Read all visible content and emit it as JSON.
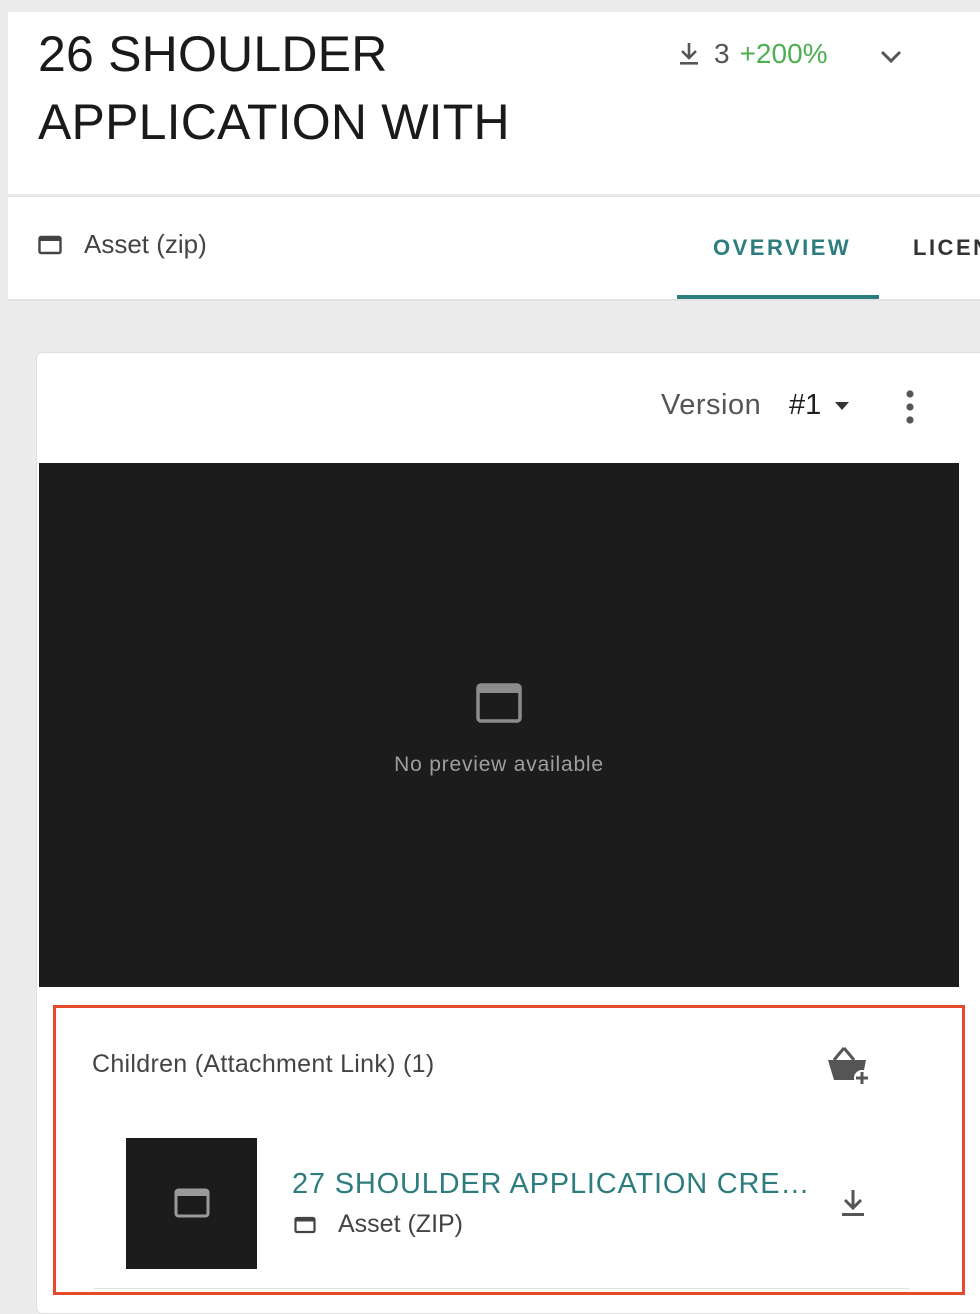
{
  "header": {
    "title": "26 SHOULDER APPLICATION WITH",
    "download_count": "3",
    "download_change": "+200%",
    "download_change_color": "#4caf50"
  },
  "asset_type": {
    "label": "Asset (zip)",
    "icon": "window-icon"
  },
  "tabs": [
    {
      "label": "OVERVIEW",
      "active": true
    },
    {
      "label": "LICEN",
      "active": false
    }
  ],
  "version": {
    "label": "Version",
    "value": "#1"
  },
  "preview": {
    "text": "No preview available",
    "icon": "window-icon"
  },
  "children": {
    "title": "Children (Attachment Link) (1)",
    "items": [
      {
        "name": "27 SHOULDER APPLICATION CRE…",
        "type": "Asset (ZIP)"
      }
    ]
  },
  "colors": {
    "accent": "#2e7d7e",
    "highlight_border": "#e64a2e",
    "preview_bg": "#1c1c1c"
  }
}
